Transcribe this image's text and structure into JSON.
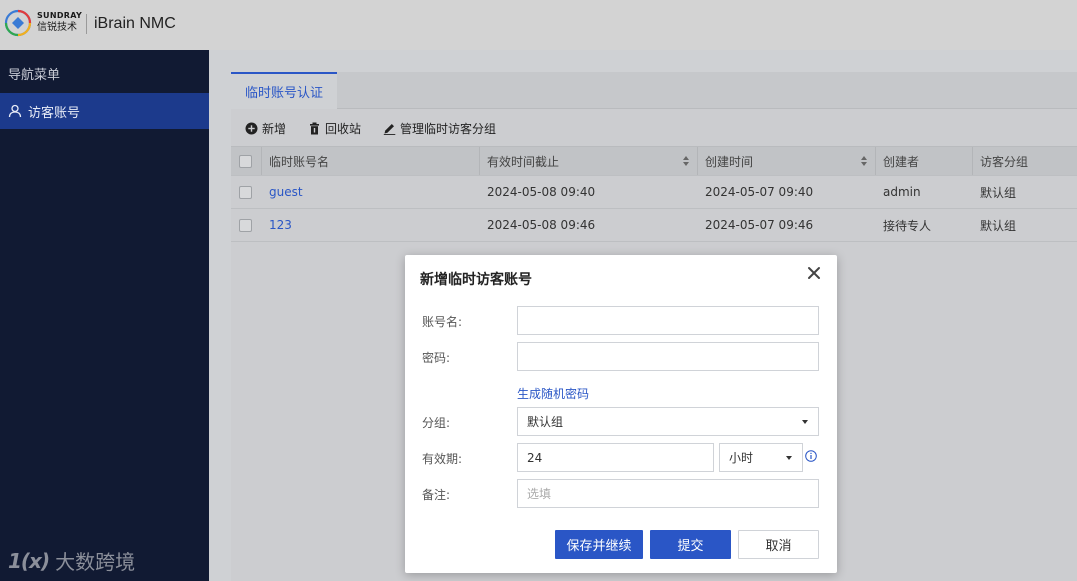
{
  "header": {
    "brand_en": "SUNDRAY",
    "brand_cn": "信锐技术",
    "product": "iBrain NMC"
  },
  "sidebar": {
    "title": "导航菜单",
    "items": [
      {
        "label": "访客账号",
        "icon": "user-icon",
        "active": true
      }
    ],
    "watermark": {
      "logo": "1(x)",
      "text": "大数跨境"
    }
  },
  "tabs": [
    {
      "label": "临时账号认证",
      "active": true
    }
  ],
  "toolbar": {
    "add_label": "新增",
    "recycle_label": "回收站",
    "manage_groups_label": "管理临时访客分组"
  },
  "table": {
    "columns": [
      "临时账号名",
      "有效时间截止",
      "创建时间",
      "创建者",
      "访客分组"
    ],
    "rows": [
      {
        "name": "guest",
        "expires": "2024-05-08 09:40",
        "created": "2024-05-07 09:40",
        "creator": "admin",
        "group": "默认组"
      },
      {
        "name": "123",
        "expires": "2024-05-08 09:46",
        "created": "2024-05-07 09:46",
        "creator": "接待专人",
        "group": "默认组"
      }
    ]
  },
  "modal": {
    "title": "新增临时访客账号",
    "account_label": "账号名:",
    "account_value": "",
    "password_label": "密码:",
    "password_value": "",
    "generate_password_link": "生成随机密码",
    "group_label": "分组:",
    "group_value": "默认组",
    "validity_label": "有效期:",
    "validity_value": "24",
    "validity_unit": "小时",
    "remark_label": "备注:",
    "remark_placeholder": "选填",
    "save_continue_label": "保存并继续",
    "submit_label": "提交",
    "cancel_label": "取消"
  },
  "colors": {
    "accent": "#2a56c6",
    "sidebar_bg": "#111a33",
    "sidebar_active": "#1c3a8c"
  }
}
